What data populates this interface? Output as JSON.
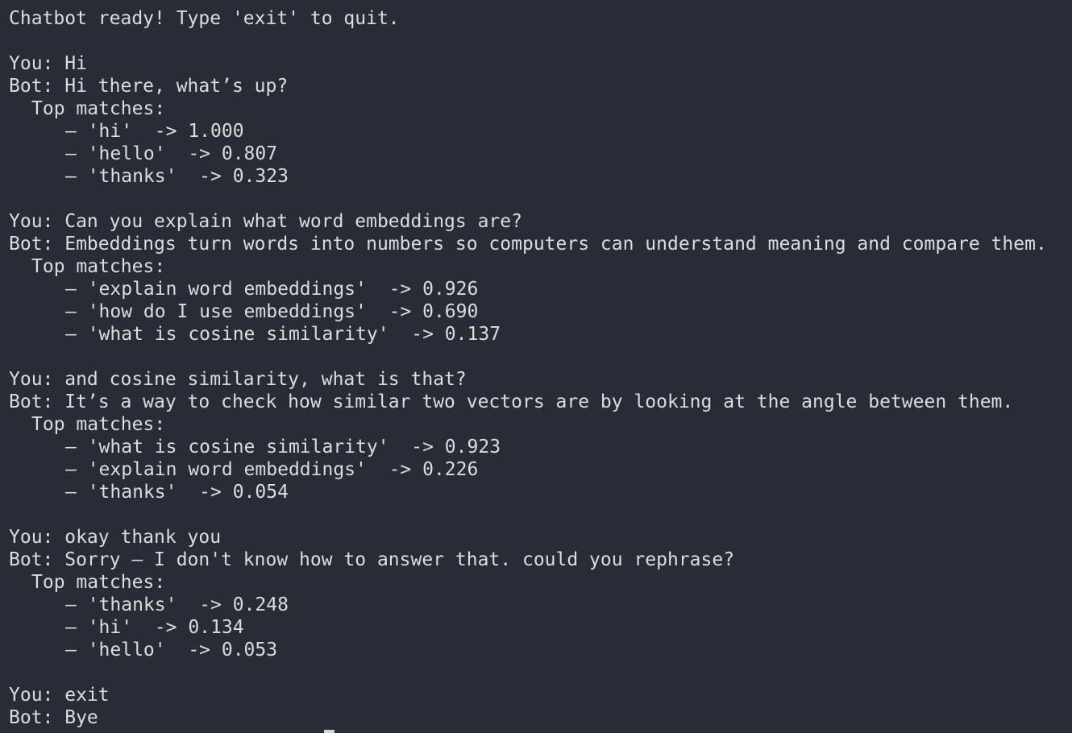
{
  "terminal": {
    "lines": [
      {
        "text": "Chatbot ready! Type 'exit' to quit.",
        "indent": 0
      },
      {
        "text": "",
        "indent": 0
      },
      {
        "text": "You: Hi",
        "indent": 0
      },
      {
        "text": "Bot: Hi there, what’s up?",
        "indent": 0
      },
      {
        "text": "Top matches:",
        "indent": 1
      },
      {
        "text": "– 'hi'  -> 1.000",
        "indent": 2
      },
      {
        "text": "– 'hello'  -> 0.807",
        "indent": 2
      },
      {
        "text": "– 'thanks'  -> 0.323",
        "indent": 2
      },
      {
        "text": "",
        "indent": 0
      },
      {
        "text": "You: Can you explain what word embeddings are?",
        "indent": 0
      },
      {
        "text": "Bot: Embeddings turn words into numbers so computers can understand meaning and compare them.",
        "indent": 0
      },
      {
        "text": "Top matches:",
        "indent": 1
      },
      {
        "text": "– 'explain word embeddings'  -> 0.926",
        "indent": 2
      },
      {
        "text": "– 'how do I use embeddings'  -> 0.690",
        "indent": 2
      },
      {
        "text": "– 'what is cosine similarity'  -> 0.137",
        "indent": 2
      },
      {
        "text": "",
        "indent": 0
      },
      {
        "text": "You: and cosine similarity, what is that?",
        "indent": 0
      },
      {
        "text": "Bot: It’s a way to check how similar two vectors are by looking at the angle between them.",
        "indent": 0
      },
      {
        "text": "Top matches:",
        "indent": 1
      },
      {
        "text": "– 'what is cosine similarity'  -> 0.923",
        "indent": 2
      },
      {
        "text": "– 'explain word embeddings'  -> 0.226",
        "indent": 2
      },
      {
        "text": "– 'thanks'  -> 0.054",
        "indent": 2
      },
      {
        "text": "",
        "indent": 0
      },
      {
        "text": "You: okay thank you",
        "indent": 0
      },
      {
        "text": "Bot: Sorry — I don't know how to answer that. could you rephrase?",
        "indent": 0
      },
      {
        "text": "Top matches:",
        "indent": 1
      },
      {
        "text": "– 'thanks'  -> 0.248",
        "indent": 2
      },
      {
        "text": "– 'hi'  -> 0.134",
        "indent": 2
      },
      {
        "text": "– 'hello'  -> 0.053",
        "indent": 2
      },
      {
        "text": "",
        "indent": 0
      },
      {
        "text": "You: exit",
        "indent": 0
      },
      {
        "text": "Bot: Bye",
        "indent": 0
      }
    ]
  },
  "colors": {
    "background": "#282c34",
    "text": "#d9dce2",
    "cursor": "#d0d3da"
  }
}
